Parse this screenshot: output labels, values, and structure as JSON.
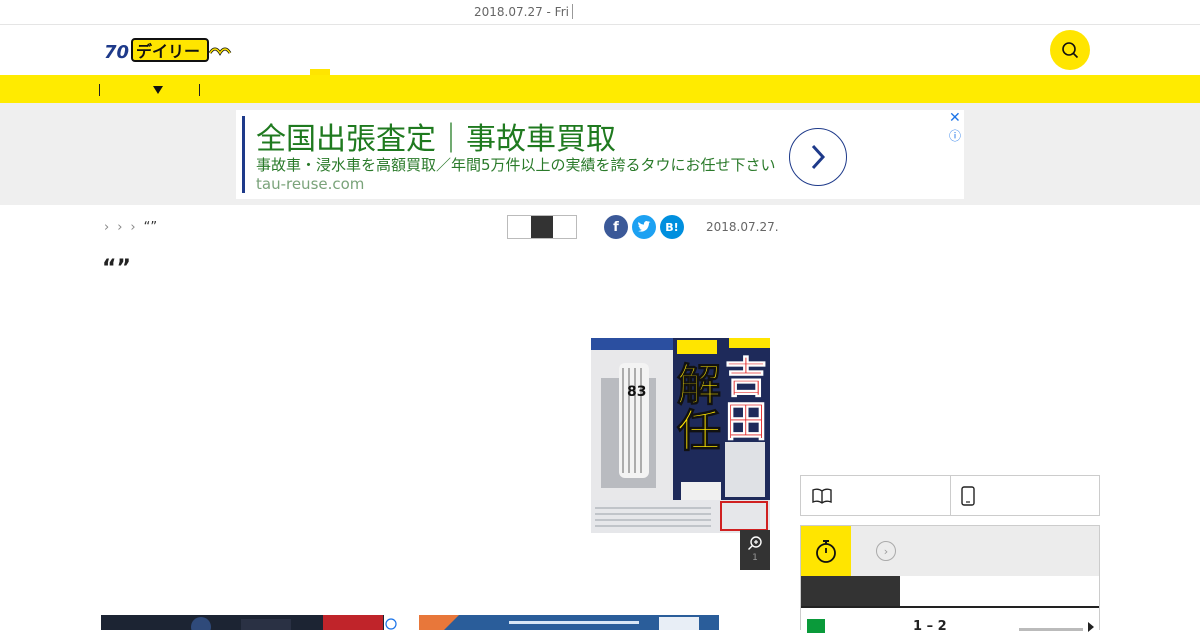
{
  "topbar": {
    "date": "2018.07.27 - Fri"
  },
  "header": {
    "logo_alt": "デイリー"
  },
  "icons": {
    "search": "search-icon",
    "nav_dropdown": "caret-down-icon",
    "ad_next": "chevron-right-icon",
    "ad_close": "close-icon",
    "ad_info": "info-icon",
    "facebook": "facebook-icon",
    "twitter": "twitter-icon",
    "hatena": "hatena-bookmark-icon",
    "zoom": "zoom-in-icon",
    "book": "book-icon",
    "phone": "smartphone-icon",
    "stopwatch": "stopwatch-icon"
  },
  "colors": {
    "brand_yellow": "#ffeb00",
    "ad_green": "#1f7a1f",
    "ad_navy": "#1e3a8a",
    "facebook": "#3b5998",
    "twitter": "#1da1f2",
    "hatena": "#008fde",
    "team_green": "#0a9a3a"
  },
  "ad": {
    "title": "全国出張査定｜事故車買取",
    "description": "事故車・浸水車を高額買取／年間5万件以上の実績を誇るタウにお任せ下さい",
    "url": "tau-reuse.com",
    "close": "✕",
    "info": "ⓘ"
  },
  "breadcrumb": {
    "current": "“”"
  },
  "share": {
    "hatena_label": "B!"
  },
  "article": {
    "date": "2018.07.27.",
    "headline": "“”",
    "image_index": "1"
  },
  "score": {
    "value": "1 – 2"
  }
}
